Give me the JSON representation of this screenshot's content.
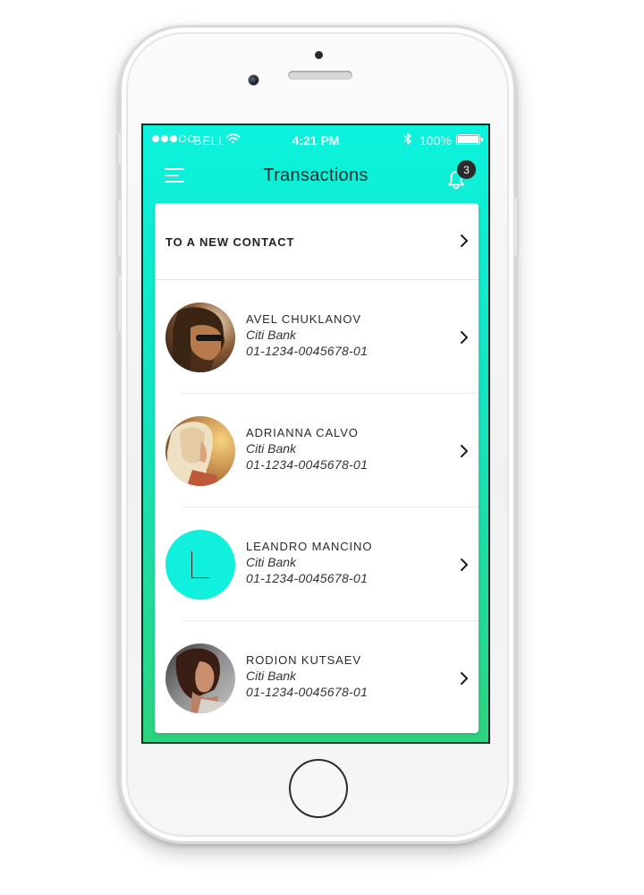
{
  "status_bar": {
    "carrier": "BELL",
    "time": "4:21 PM",
    "battery": "100%",
    "signal_bars": 3,
    "signal_total": 5
  },
  "header": {
    "title": "Transactions",
    "notification_count": "3"
  },
  "new_contact": {
    "label": "TO A NEW CONTACT"
  },
  "contacts": [
    {
      "name": "AVEL CHUKLANOV",
      "bank": "Citi Bank",
      "account": "01-1234-0045678-01",
      "avatar": "photo-man-sunglasses"
    },
    {
      "name": "ADRIANNA CALVO",
      "bank": "Citi Bank",
      "account": "01-1234-0045678-01",
      "avatar": "photo-blonde-woman"
    },
    {
      "name": "LEANDRO MANCINO",
      "bank": "Citi Bank",
      "account": "01-1234-0045678-01",
      "avatar": "initial-l"
    },
    {
      "name": "RODION KUTSAEV",
      "bank": "Citi Bank",
      "account": "01-1234-0045678-01",
      "avatar": "photo-dark-hair-woman"
    }
  ],
  "colors": {
    "gradient_top": "#0cf2dd",
    "gradient_bottom": "#2dd47f",
    "initial_avatar": "#10f0dc",
    "badge": "#2b2b2b"
  },
  "icons": [
    "wifi-icon",
    "bluetooth-icon",
    "battery-icon",
    "menu-icon",
    "bell-icon",
    "chevron-right-icon"
  ]
}
